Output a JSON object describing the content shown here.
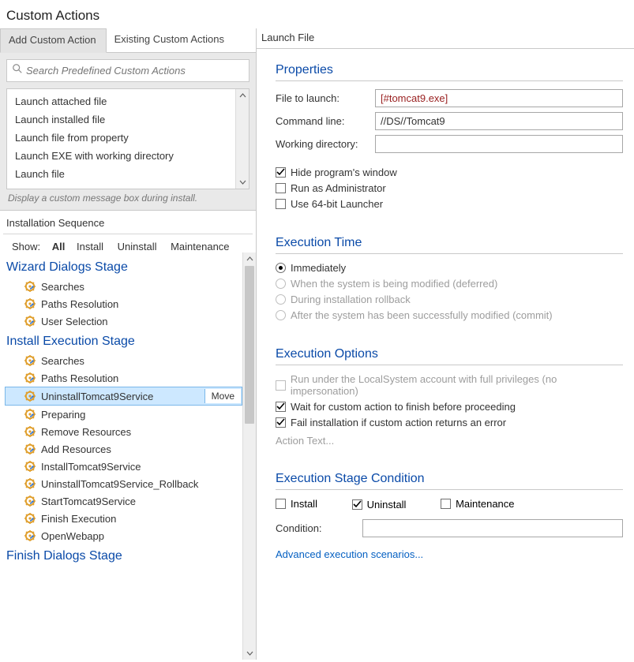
{
  "title": "Custom Actions",
  "tabs": {
    "add": "Add Custom Action",
    "existing": "Existing Custom Actions"
  },
  "search": {
    "placeholder": "Search Predefined Custom Actions"
  },
  "predef_list": [
    "Launch attached file",
    "Launch installed file",
    "Launch file from property",
    "Launch EXE with working directory",
    "Launch file"
  ],
  "hint": "Display a custom message box during install.",
  "seq_title": "Installation Sequence",
  "show": {
    "label": "Show:",
    "all": "All",
    "install": "Install",
    "uninstall": "Uninstall",
    "maintenance": "Maintenance"
  },
  "stages": {
    "wizard": "Wizard Dialogs Stage",
    "install": "Install Execution Stage",
    "finish": "Finish Dialogs Stage"
  },
  "wizard_items": [
    "Searches",
    "Paths Resolution",
    "User Selection"
  ],
  "install_items": [
    "Searches",
    "Paths Resolution",
    "UninstallTomcat9Service",
    "Preparing",
    "Remove Resources",
    "Add Resources",
    "InstallTomcat9Service",
    "UninstallTomcat9Service_Rollback",
    "StartTomcat9Service",
    "Finish Execution",
    "OpenWebapp"
  ],
  "selected_install_index": 2,
  "move_label": "Move",
  "right_title": "Launch File",
  "props": {
    "heading": "Properties",
    "file_lbl": "File to launch:",
    "file_val": "[#tomcat9.exe]",
    "cmd_lbl": "Command line:",
    "cmd_val": "//DS//Tomcat9",
    "wd_lbl": "Working directory:",
    "wd_val": "",
    "hide": "Hide program's window",
    "admin": "Run as Administrator",
    "bit64": "Use 64-bit Launcher"
  },
  "exec_time": {
    "heading": "Execution Time",
    "imm": "Immediately",
    "deferred": "When the system is being modified (deferred)",
    "rollback": "During installation rollback",
    "commit": "After the system has been successfully modified (commit)"
  },
  "exec_opts": {
    "heading": "Execution Options",
    "localsys": "Run under the LocalSystem account with full privileges (no impersonation)",
    "wait": "Wait for custom action to finish before proceeding",
    "fail": "Fail installation if custom action returns an error",
    "action_text": "Action Text..."
  },
  "stage_cond": {
    "heading": "Execution Stage Condition",
    "install": "Install",
    "uninstall": "Uninstall",
    "maintenance": "Maintenance",
    "cond_lbl": "Condition:",
    "cond_val": "",
    "adv": "Advanced execution scenarios..."
  }
}
